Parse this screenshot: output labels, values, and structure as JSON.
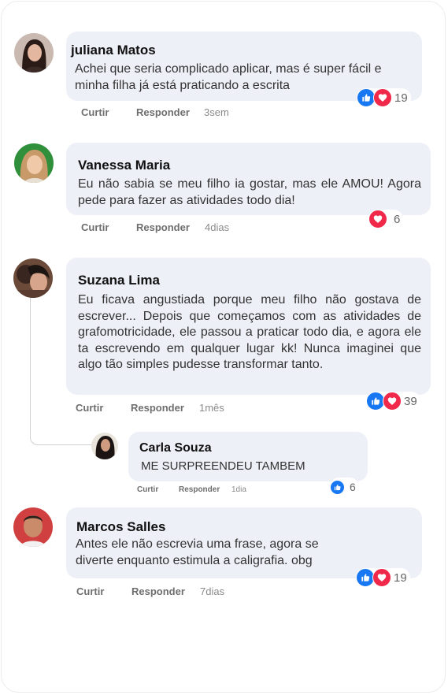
{
  "colors": {
    "like": "#1877f2",
    "love": "#f0284a",
    "bubble": "#eef0f8"
  },
  "comments": [
    {
      "author": "juliana Matos",
      "text": "Achei que seria complicado aplicar, mas é super fácil e minha filha já está praticando a escrita",
      "like_label": "Curtir",
      "reply_label": "Responder",
      "time": "3sem",
      "reactions": [
        "like-icon",
        "love-icon"
      ],
      "reaction_count": "19"
    },
    {
      "author": "Vanessa Maria",
      "text": "Eu não sabia se meu filho ia gostar, mas ele AMOU! Agora pede para fazer as atividades todo dia!",
      "like_label": "Curtir",
      "reply_label": "Responder",
      "time": "4dias",
      "reactions": [
        "love-icon"
      ],
      "reaction_count": "6"
    },
    {
      "author": "Suzana Lima",
      "text": "Eu ficava angustiada porque meu filho não gostava de escrever... Depois que começamos com as atividades de grafomotricidade, ele passou a praticar todo dia, e agora ele ta escrevendo em qualquer lugar kk! Nunca imaginei que algo tão simples pudesse transformar tanto.",
      "like_label": "Curtir",
      "reply_label": "Responder",
      "time": "1mês",
      "reactions": [
        "like-icon",
        "love-icon"
      ],
      "reaction_count": "39",
      "reply": {
        "author": "Carla Souza",
        "text": "ME SURPREENDEU TAMBEM",
        "like_label": "Curtir",
        "reply_label": "Responder",
        "time": "1dia",
        "reactions": [
          "like-icon"
        ],
        "reaction_count": "6"
      }
    },
    {
      "author": "Marcos Salles",
      "text": "Antes ele não escrevia uma frase, agora se diverte enquanto estimula a caligrafia. obg",
      "like_label": "Curtir",
      "reply_label": "Responder",
      "time": "7dias",
      "reactions": [
        "like-icon",
        "love-icon"
      ],
      "reaction_count": "19"
    }
  ]
}
